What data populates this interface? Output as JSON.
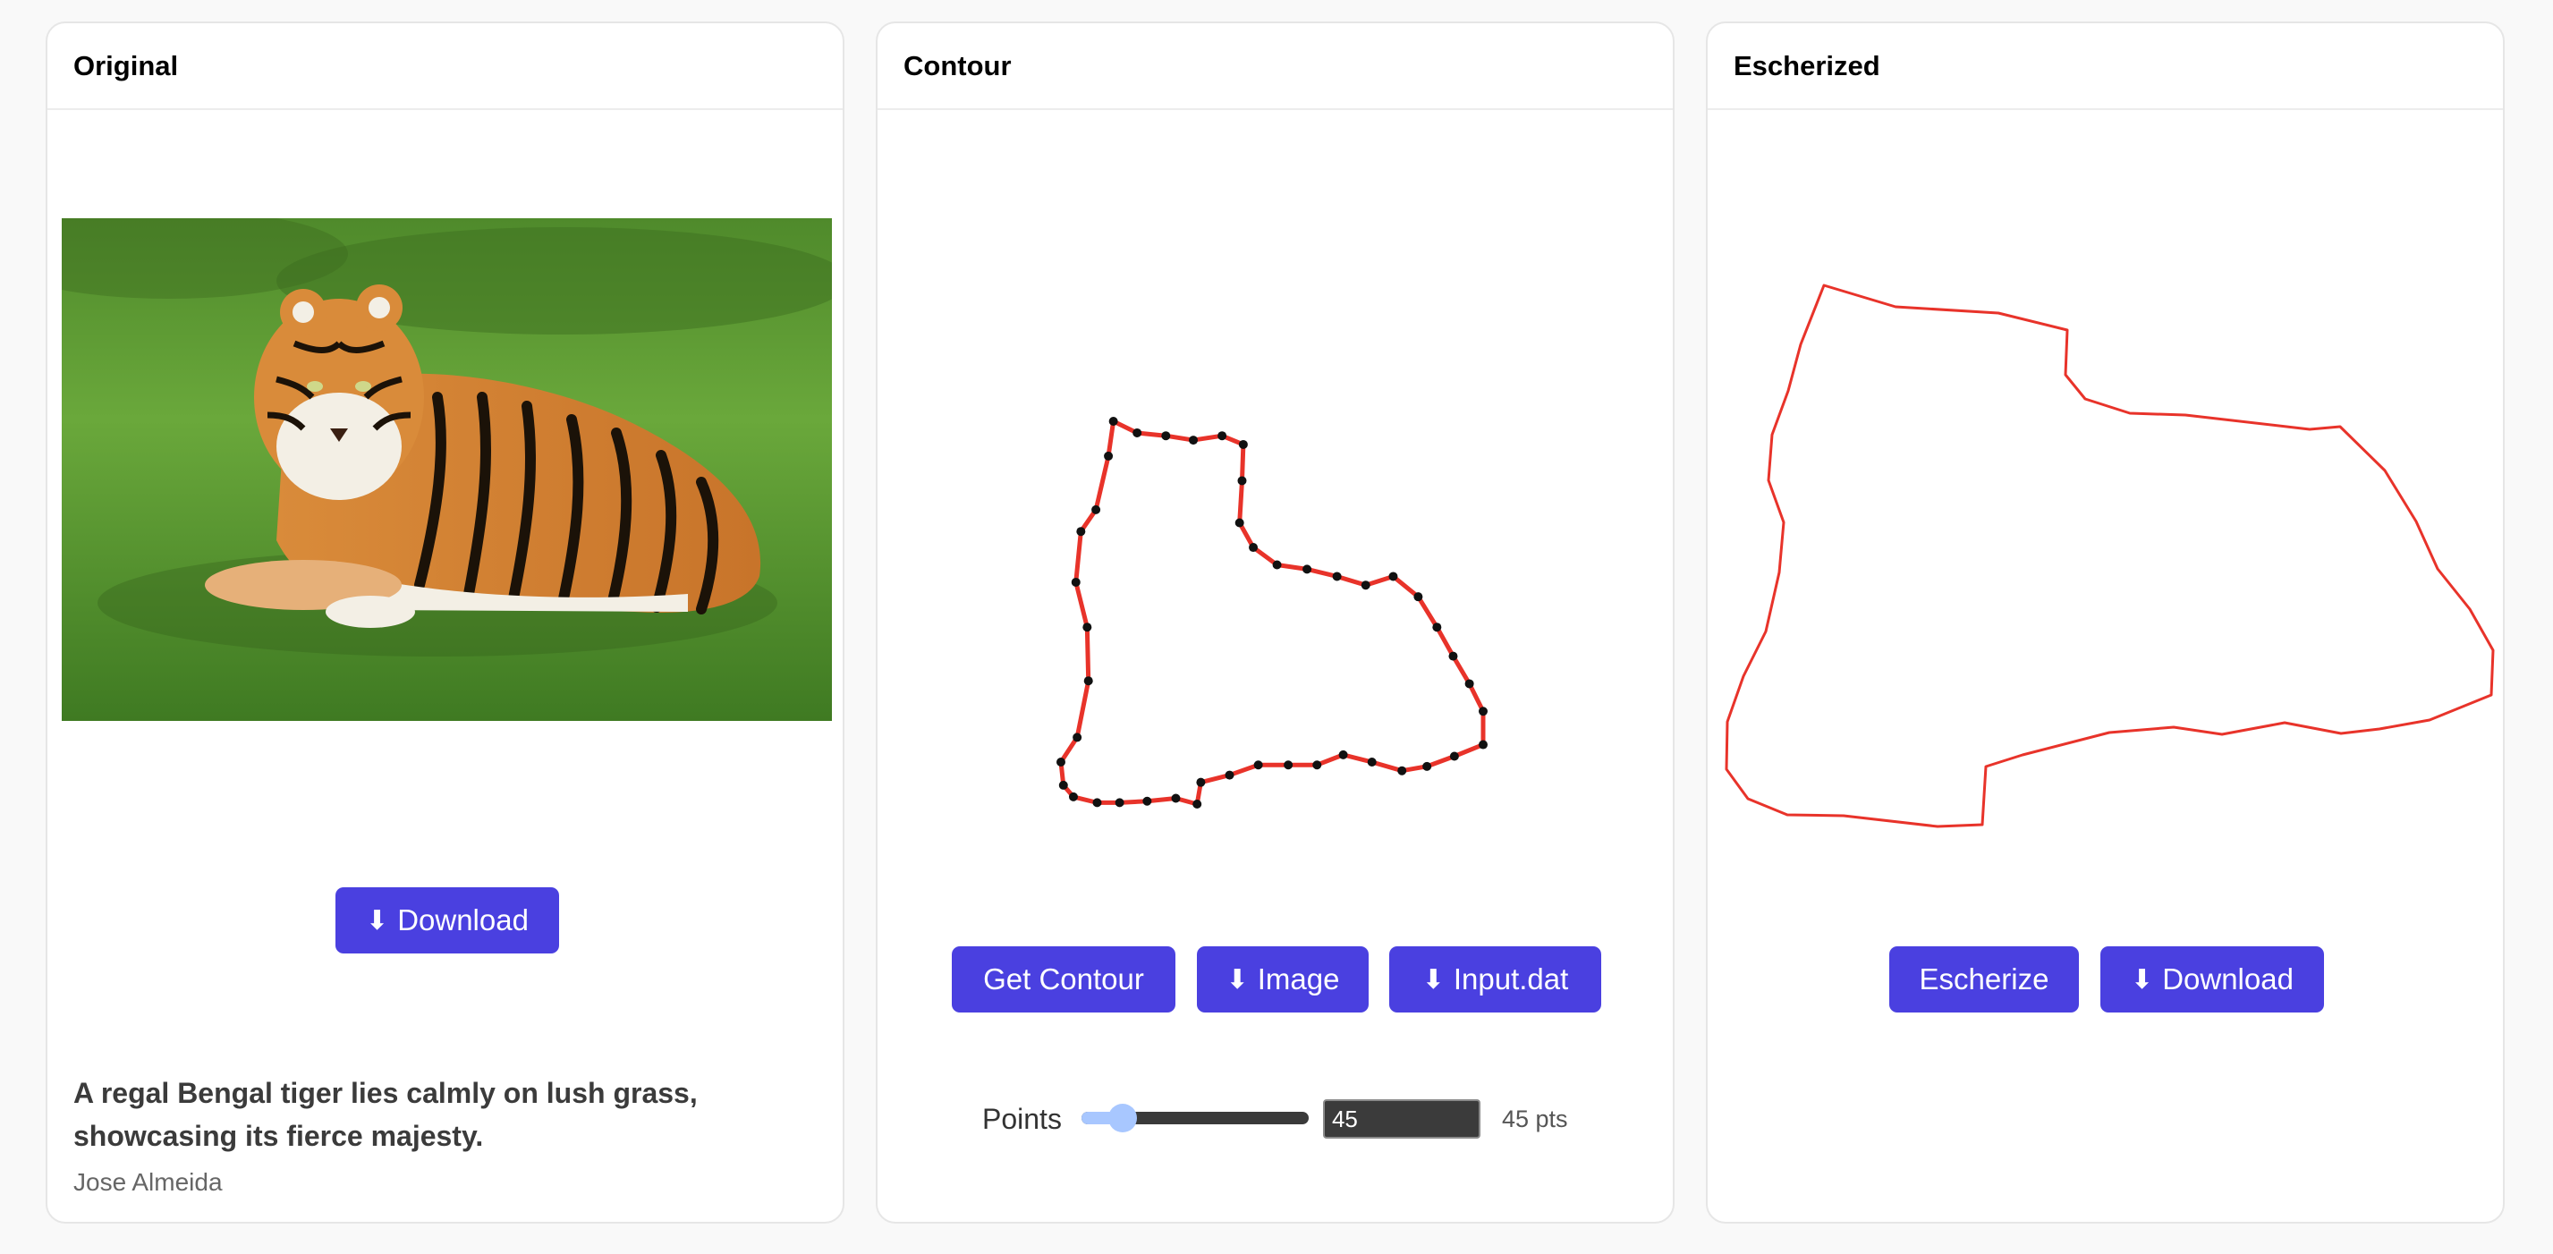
{
  "panels": {
    "original": {
      "title": "Original",
      "download_label": "Download",
      "download_icon": "download-arrow-icon",
      "caption": "A regal Bengal tiger lies calmly on lush grass, showcasing its fierce majesty.",
      "author": "Jose Almeida"
    },
    "contour": {
      "title": "Contour",
      "get_contour_label": "Get Contour",
      "image_label": "Image",
      "input_dat_label": "Input.dat",
      "points_label": "Points",
      "points_value": "45",
      "points_readout": "45 pts",
      "slider_level": 0.18
    },
    "escherized": {
      "title": "Escherized",
      "escherize_label": "Escherize",
      "download_label": "Download"
    }
  },
  "colors": {
    "accent": "#4a40e0",
    "contour_stroke": "#e8332a",
    "point": "#111111"
  }
}
